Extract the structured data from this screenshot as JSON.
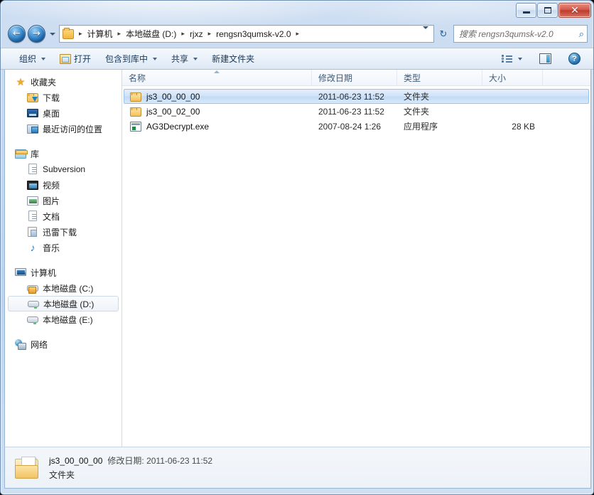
{
  "window": {
    "caption_buttons": [
      {
        "name": "minimize",
        "glyph": "—"
      },
      {
        "name": "maximize",
        "glyph": "❐"
      },
      {
        "name": "close",
        "glyph": "✕"
      }
    ]
  },
  "address": {
    "back_arrow": "←",
    "forward_arrow": "→",
    "crumbs": [
      "计算机",
      "本地磁盘 (D:)",
      "rjxz",
      "rengsn3qumsk-v2.0"
    ],
    "separator": "▸",
    "refresh_glyph": "↻",
    "dropdown_glyph": "▼"
  },
  "search": {
    "placeholder": "搜索 rengsn3qumsk-v2.0",
    "icon": "search-icon",
    "icon_glyph": "⌕"
  },
  "toolbar": {
    "items": [
      {
        "label": "组织",
        "has_caret": true,
        "icon": null
      },
      {
        "label": "打开",
        "has_caret": false,
        "icon": "open-folder-icon"
      },
      {
        "label": "包含到库中",
        "has_caret": true,
        "icon": null
      },
      {
        "label": "共享",
        "has_caret": true,
        "icon": null
      },
      {
        "label": "新建文件夹",
        "has_caret": false,
        "icon": null
      }
    ],
    "view_button": "change-view-button",
    "preview_button": "preview-pane-button",
    "help_button": "help-button",
    "help_glyph": "?"
  },
  "navpane": {
    "groups": [
      {
        "header": {
          "label": "收藏夹",
          "icon": "star-icon"
        },
        "items": [
          {
            "label": "下载",
            "icon": "downloads-icon"
          },
          {
            "label": "桌面",
            "icon": "desktop-icon"
          },
          {
            "label": "最近访问的位置",
            "icon": "recent-places-icon"
          }
        ]
      },
      {
        "header": {
          "label": "库",
          "icon": "libraries-icon"
        },
        "items": [
          {
            "label": "Subversion",
            "icon": "document-library-icon"
          },
          {
            "label": "视频",
            "icon": "videos-icon"
          },
          {
            "label": "图片",
            "icon": "pictures-icon"
          },
          {
            "label": "文档",
            "icon": "documents-icon"
          },
          {
            "label": "迅雷下载",
            "icon": "thunder-download-icon"
          },
          {
            "label": "音乐",
            "icon": "music-icon"
          }
        ]
      },
      {
        "header": {
          "label": "计算机",
          "icon": "computer-icon"
        },
        "items": [
          {
            "label": "本地磁盘 (C:)",
            "icon": "system-drive-icon",
            "selected": false
          },
          {
            "label": "本地磁盘 (D:)",
            "icon": "drive-icon",
            "selected": true
          },
          {
            "label": "本地磁盘 (E:)",
            "icon": "drive-icon",
            "selected": false
          }
        ]
      },
      {
        "header": {
          "label": "网络",
          "icon": "network-icon"
        },
        "items": []
      }
    ]
  },
  "filelist": {
    "columns": [
      {
        "label": "名称",
        "key": "name",
        "sorted": true
      },
      {
        "label": "修改日期",
        "key": "date",
        "sorted": false
      },
      {
        "label": "类型",
        "key": "type",
        "sorted": false
      },
      {
        "label": "大小",
        "key": "size",
        "sorted": false
      }
    ],
    "rows": [
      {
        "name": "js3_00_00_00",
        "date": "2011-06-23 11:52",
        "type": "文件夹",
        "size": "",
        "icon": "folder-icon",
        "selected": true
      },
      {
        "name": "js3_00_02_00",
        "date": "2011-06-23 11:52",
        "type": "文件夹",
        "size": "",
        "icon": "folder-icon",
        "selected": false
      },
      {
        "name": "AG3Decrypt.exe",
        "date": "2007-08-24 1:26",
        "type": "应用程序",
        "size": "28 KB",
        "icon": "exe-icon",
        "selected": false
      }
    ]
  },
  "statusbar": {
    "name": "js3_00_00_00",
    "date_label": "修改日期: 2011-06-23 11:52",
    "type": "文件夹",
    "icon": "folder-large-icon"
  },
  "colors": {
    "accent": "#2d6aa8",
    "selection": "#cfe3f8",
    "glass": "#c5d8ef",
    "close_red": "#bc3c2c"
  }
}
